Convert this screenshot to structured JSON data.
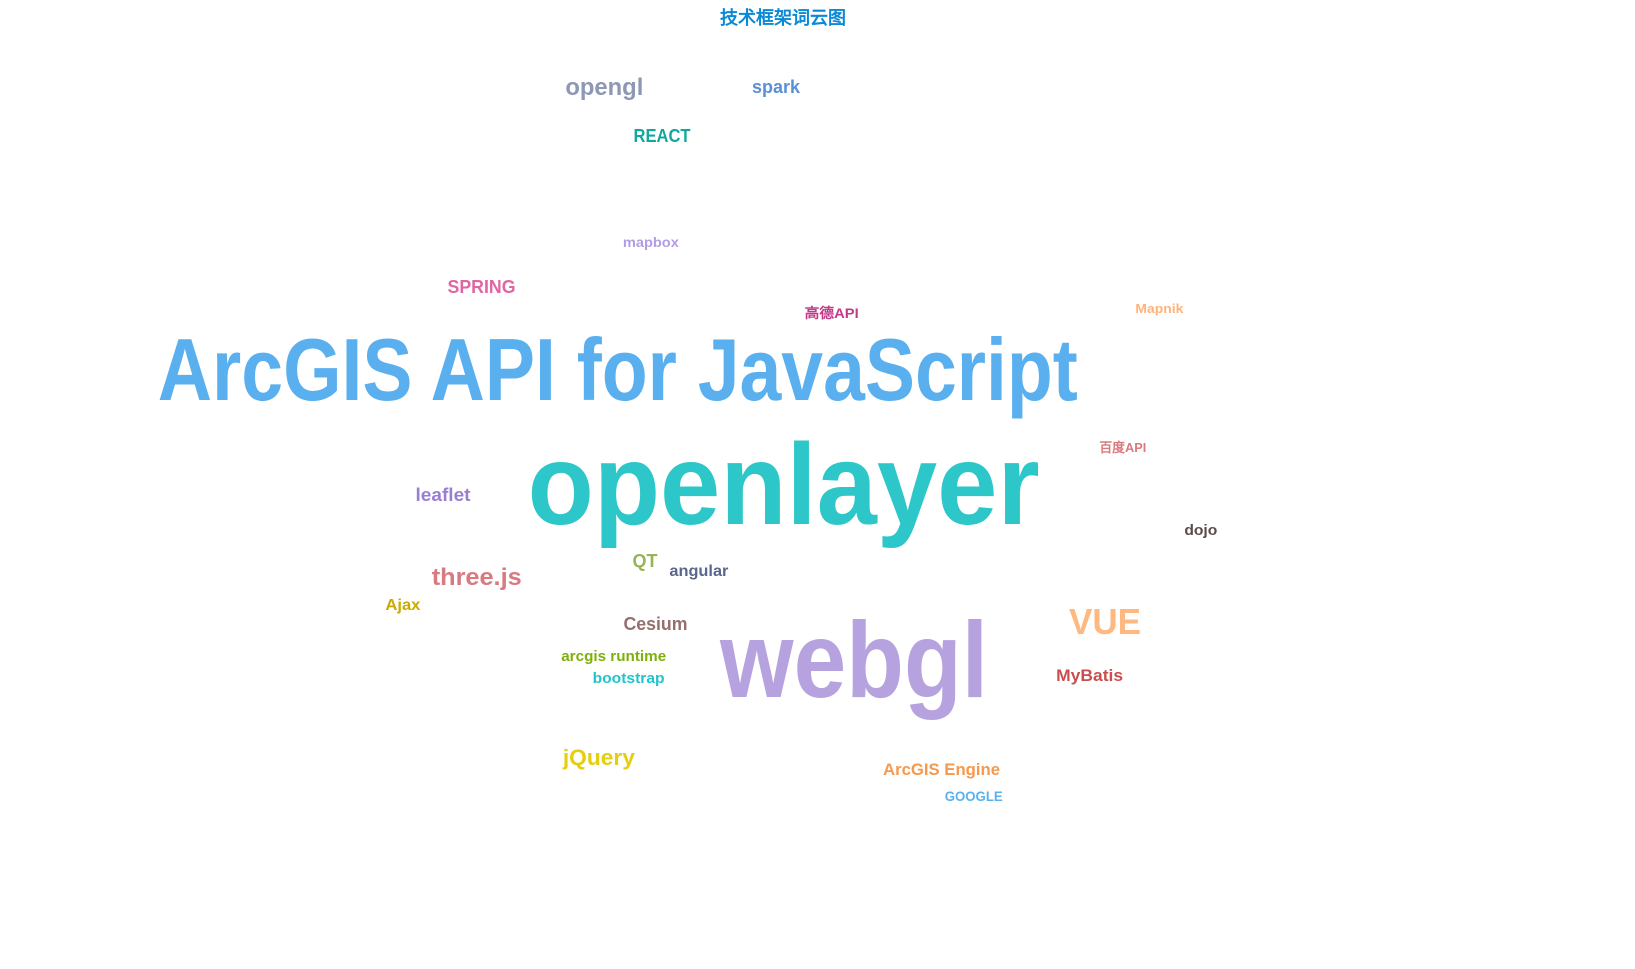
{
  "chart_data": {
    "type": "wordcloud",
    "title": "技术框架词云图",
    "title_color": "#0a8ad6",
    "words": [
      {
        "text": "opengl",
        "color": "#8d98b3"
      },
      {
        "text": "spark",
        "color": "#5b8fd9"
      },
      {
        "text": "REACT",
        "color": "#13a89e"
      },
      {
        "text": "mapbox",
        "color": "#b39ce6"
      },
      {
        "text": "SPRING",
        "color": "#e066a3"
      },
      {
        "text": "高德API",
        "color": "#c23a8a"
      },
      {
        "text": "Mapnik",
        "color": "#ffb27a"
      },
      {
        "text": "ArcGIS API for JavaScript",
        "color": "#5aafee"
      },
      {
        "text": "openlayer",
        "color": "#2ec7c9"
      },
      {
        "text": "百度API",
        "color": "#d87a80"
      },
      {
        "text": "leaflet",
        "color": "#9a7fd1"
      },
      {
        "text": "dojo",
        "color": "#5d4b4b"
      },
      {
        "text": "three.js",
        "color": "#d87a80"
      },
      {
        "text": "QT",
        "color": "#97b552"
      },
      {
        "text": "angular",
        "color": "#59678c"
      },
      {
        "text": "Ajax",
        "color": "#c9ab00"
      },
      {
        "text": "Cesium",
        "color": "#95706d"
      },
      {
        "text": "VUE",
        "color": "#ffb980"
      },
      {
        "text": "webgl",
        "color": "#b6a2de"
      },
      {
        "text": "arcgis runtime",
        "color": "#7eb00a"
      },
      {
        "text": "bootstrap",
        "color": "#22c3cc"
      },
      {
        "text": "MyBatis",
        "color": "#c94f4f"
      },
      {
        "text": "jQuery",
        "color": "#e5cf0d"
      },
      {
        "text": "ArcGIS Engine",
        "color": "#f5994e"
      },
      {
        "text": "GOOGLE",
        "color": "#5ab1ef"
      }
    ]
  }
}
